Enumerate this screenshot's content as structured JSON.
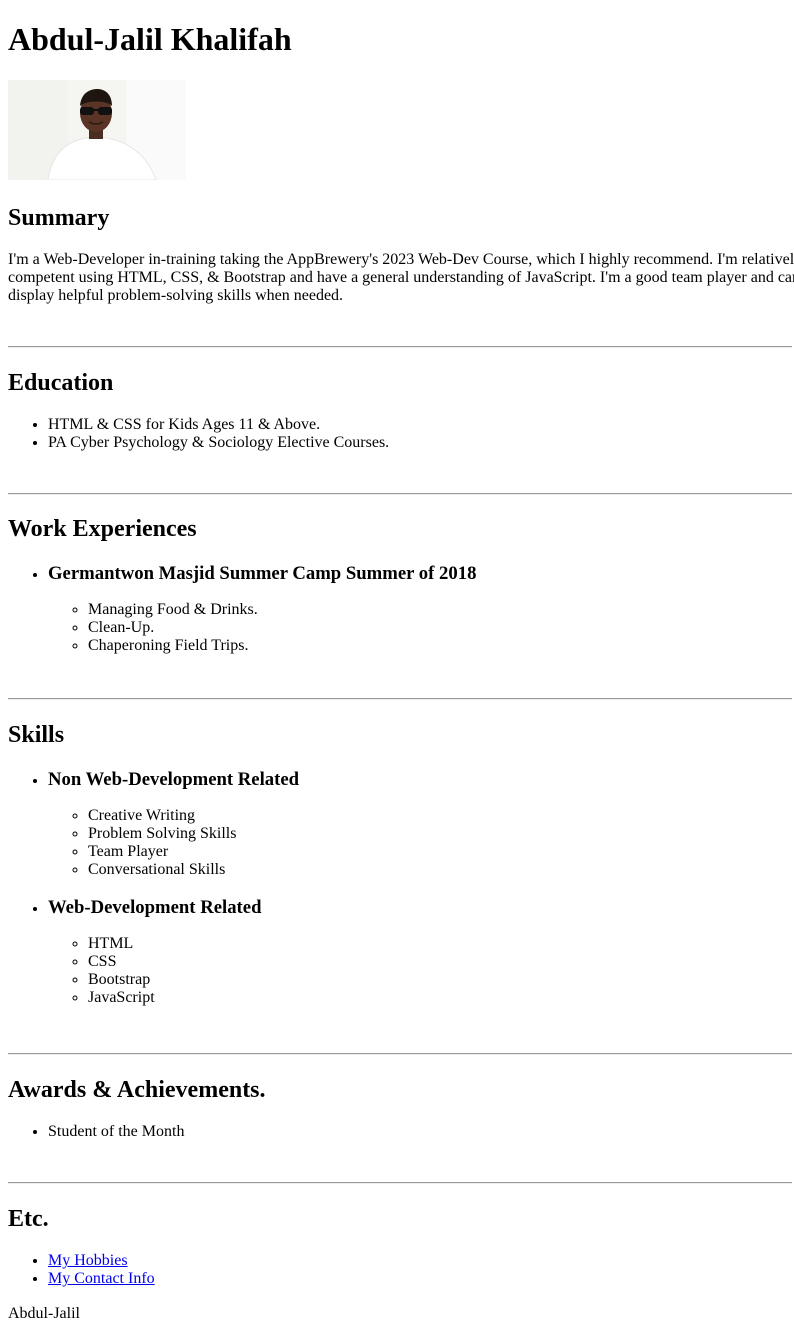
{
  "header": {
    "name": "Abdul-Jalil Khalifah"
  },
  "summary": {
    "heading": "Summary",
    "lines": [
      "I'm a Web-Developer in-training taking the AppBrewery's 2023 Web-Dev Course, which I highly recommend. I'm relativel",
      "competent using HTML, CSS, & Bootstrap and have a general understanding of JavaScript. I'm a good team player and can",
      "display helpful problem-solving skills when needed."
    ]
  },
  "education": {
    "heading": "Education",
    "items": [
      "HTML & CSS for Kids Ages 11 & Above.",
      "PA Cyber Psychology & Sociology Elective Courses."
    ]
  },
  "work": {
    "heading": "Work Experiences",
    "jobs": [
      {
        "title": "Germantwon Masjid Summer Camp Summer of 2018",
        "duties": [
          "Managing Food & Drinks.",
          "Clean-Up.",
          "Chaperoning Field Trips."
        ]
      }
    ]
  },
  "skills": {
    "heading": "Skills",
    "groups": [
      {
        "title": "Non Web-Development Related",
        "items": [
          "Creative Writing",
          "Problem Solving Skills",
          "Team Player",
          "Conversational Skills"
        ]
      },
      {
        "title": "Web-Development Related",
        "items": [
          "HTML",
          "CSS",
          "Bootstrap",
          "JavaScript"
        ]
      }
    ]
  },
  "awards": {
    "heading": "Awards & Achievements.",
    "items": [
      "Student of the Month"
    ]
  },
  "etc": {
    "heading": "Etc.",
    "links": [
      "My Hobbies",
      "My Contact Info"
    ]
  },
  "footer": {
    "signature": "Abdul-Jalil"
  },
  "colors": {
    "link": "#0000ee",
    "rule": "#9a9a9a"
  }
}
